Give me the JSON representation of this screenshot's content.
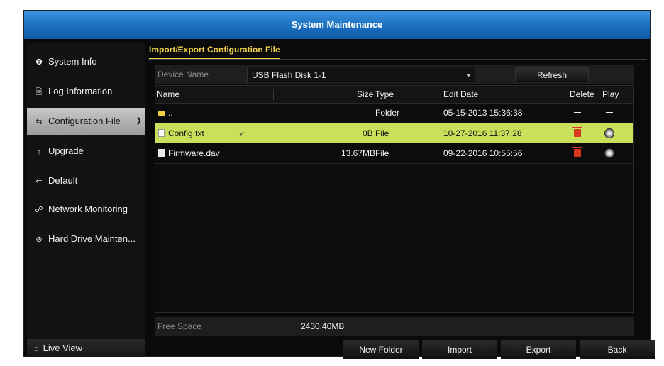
{
  "window": {
    "title": "System Maintenance"
  },
  "sidebar": {
    "items": [
      {
        "label": "System Info",
        "icon": "info-icon",
        "glyph": "❶"
      },
      {
        "label": "Log Information",
        "icon": "log-icon",
        "glyph": "🗎"
      },
      {
        "label": "Configuration File",
        "icon": "config-icon",
        "glyph": "⇆",
        "active": true
      },
      {
        "label": "Upgrade",
        "icon": "upgrade-icon",
        "glyph": "↑"
      },
      {
        "label": "Default",
        "icon": "default-icon",
        "glyph": "⇐"
      },
      {
        "label": "Network Monitoring",
        "icon": "network-icon",
        "glyph": "☍"
      },
      {
        "label": "Hard Drive Mainten...",
        "icon": "hdd-icon",
        "glyph": "⊘"
      }
    ],
    "live_view_label": "Live View"
  },
  "content": {
    "tab_label": "Import/Export Configuration File",
    "device": {
      "label": "Device Name",
      "value": "USB Flash Disk 1-1",
      "refresh_label": "Refresh"
    },
    "table": {
      "headers": {
        "name": "Name",
        "size": "Size",
        "type": "Type",
        "edit_date": "Edit Date",
        "delete": "Delete",
        "play": "Play"
      },
      "rows": [
        {
          "name": "..",
          "size": "",
          "type": "Folder",
          "edit_date": "05-15-2013 15:36:38"
        },
        {
          "name": "Config.txt",
          "size": "0B",
          "type": "File",
          "edit_date": "10-27-2016 11:37:28"
        },
        {
          "name": "Firmware.dav",
          "size": "13.67MB",
          "type": "File",
          "edit_date": "09-22-2016 10:55:56"
        }
      ]
    },
    "free_space": {
      "label": "Free Space",
      "value": "2430.40MB"
    }
  },
  "buttons": {
    "new_folder": "New Folder",
    "import": "Import",
    "export": "Export",
    "back": "Back"
  },
  "colors": {
    "title_bar": "#1a6fbf",
    "accent_tab": "#f2d24a",
    "selected_row": "#c8e05a",
    "delete": "#d9381e"
  }
}
